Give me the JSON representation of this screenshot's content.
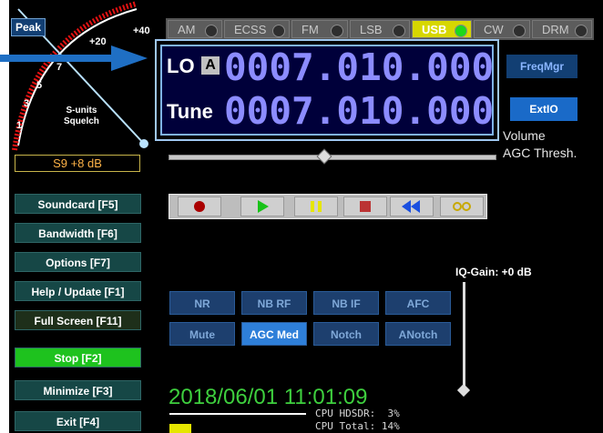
{
  "meter": {
    "peak_label": "Peak",
    "scale": [
      "+40",
      "+20",
      "7",
      "5",
      "3",
      "1"
    ],
    "units_label_1": "S-units",
    "units_label_2": "Squelch",
    "readout": "S9 +8 dB"
  },
  "modes": [
    {
      "label": "AM",
      "active": false
    },
    {
      "label": "ECSS",
      "active": false
    },
    {
      "label": "FM",
      "active": false
    },
    {
      "label": "LSB",
      "active": false
    },
    {
      "label": "USB",
      "active": true
    },
    {
      "label": "CW",
      "active": false
    },
    {
      "label": "DRM",
      "active": false
    }
  ],
  "freq": {
    "lo_label": "LO",
    "lo_vfo": "A",
    "lo_value": "0007.010.000",
    "tune_label": "Tune",
    "tune_value": "0007.010.000"
  },
  "right": {
    "freqmgr": "FreqMgr",
    "extio": "ExtIO",
    "volume": "Volume",
    "agc_thresh": "AGC Thresh."
  },
  "menu": {
    "soundcard": "Soundcard  [F5]",
    "bandwidth": "Bandwidth  [F6]",
    "options": "Options    [F7]",
    "help": "Help / Update  [F1]",
    "fullscreen": "Full Screen  [F11]",
    "stop": "Stop        [F2]",
    "minimize": "Minimize  [F3]",
    "exit": "Exit       [F4]"
  },
  "dsp": {
    "nr": "NR",
    "nbrf": "NB RF",
    "nbif": "NB IF",
    "afc": "AFC",
    "mute": "Mute",
    "agc": "AGC Med",
    "notch": "Notch",
    "anotch": "ANotch"
  },
  "iq_gain": "IQ-Gain: +0 dB",
  "datetime": "2018/06/01 11:01:09",
  "cpu": {
    "line1": "CPU HDSDR:  3%",
    "line2": "CPU Total: 14%"
  },
  "colors": {
    "accent_blue": "#1a6ac8",
    "active_mode": "#d7d700",
    "stop_green": "#1ec21e",
    "freq_digits": "#8c8cff"
  }
}
